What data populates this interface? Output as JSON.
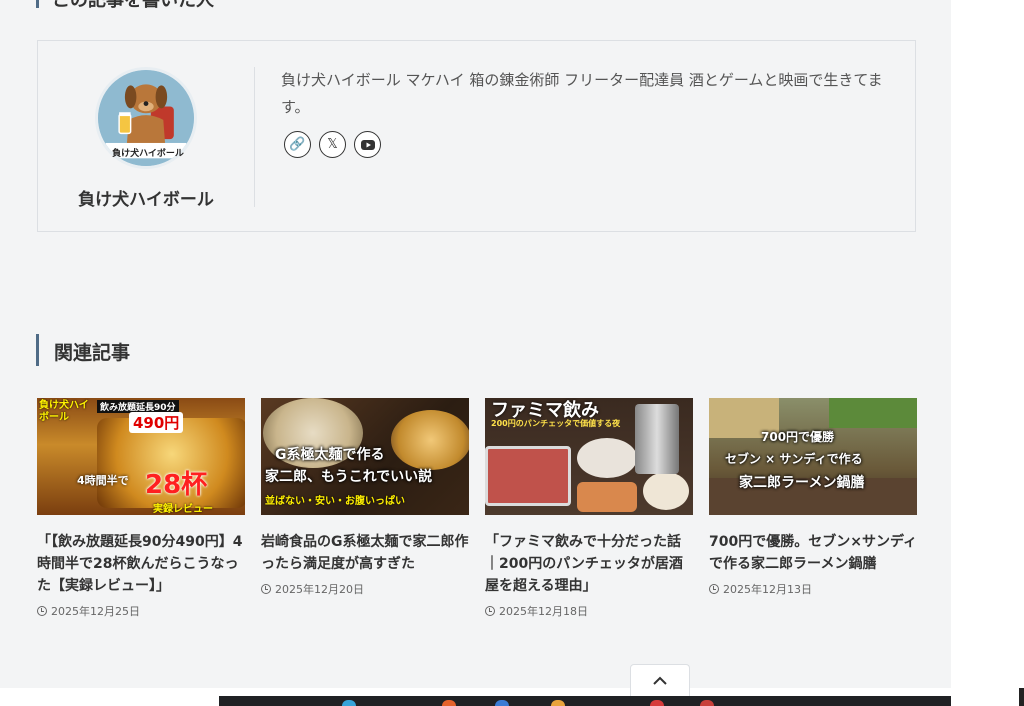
{
  "top_heading": "この記事を書いた人",
  "author": {
    "name": "負け犬ハイボール",
    "bio": "負け犬ハイボール マケハイ 箱の錬金術師 フリーター配達員 酒とゲームと映画で生きてます。",
    "avatar_caption": "負け犬ハイボール",
    "sns": [
      {
        "icon": "link-icon",
        "glyph": "🔗"
      },
      {
        "icon": "x-icon",
        "glyph": "𝕏"
      },
      {
        "icon": "youtube-icon",
        "glyph": "▶"
      }
    ]
  },
  "related": {
    "title": "関連記事",
    "cards": [
      {
        "title": "「【飲み放題延長90分490円】4時間半で28杯飲んだらこうなった【実録レビュー】」",
        "date": "2025年12月25日",
        "thumb": {
          "line1": "負け犬ハイボール",
          "line2": "飲み放題延長90分",
          "line3": "490円",
          "line4": "4時間半で",
          "line5": "28杯",
          "line6": "実録レビュー"
        }
      },
      {
        "title": "岩崎食品のG系極太麺で家二郎作ったら満足度が高すぎた",
        "date": "2025年12月20日",
        "thumb": {
          "line1": "G系極太麺で作る",
          "line2": "家二郎、もうこれでいい説",
          "line3": "並ばない・安い・お腹いっぱい"
        }
      },
      {
        "title": "「ファミマ飲みで十分だった話｜200円のパンチェッタが居酒屋を超える理由」",
        "date": "2025年12月18日",
        "thumb": {
          "line1": "ファミマ飲み",
          "line2": "200円のパンチェッタで価値する夜"
        }
      },
      {
        "title": "700円で優勝。セブン×サンディで作る家二郎ラーメン鍋膳",
        "date": "2025年12月13日",
        "thumb": {
          "line1": "700円で優勝",
          "line2": "セブン × サンディで作る",
          "line3": "家二郎ラーメン鍋膳"
        }
      }
    ]
  },
  "colors": {
    "accent": "#4f6b86",
    "background": "#f3f4f5"
  }
}
